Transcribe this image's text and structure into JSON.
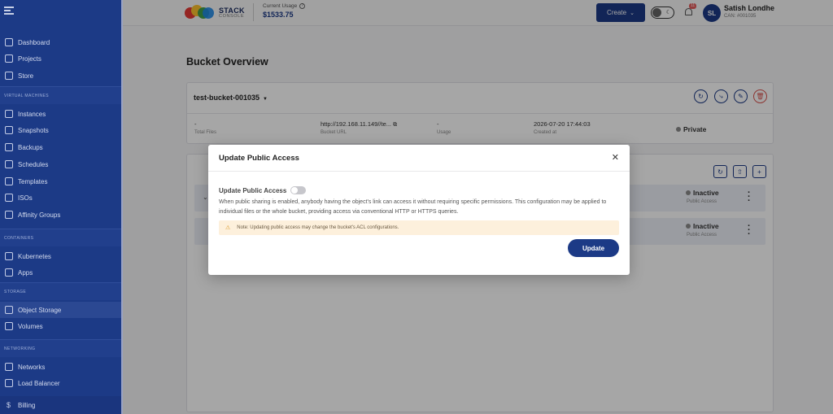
{
  "sidebar": {
    "top_items": [
      {
        "label": "Dashboard",
        "icon": "home-icon"
      },
      {
        "label": "Projects",
        "icon": "box-icon"
      },
      {
        "label": "Store",
        "icon": "cart-icon"
      }
    ],
    "sections": [
      {
        "title": "VIRTUAL MACHINES",
        "items": [
          {
            "label": "Instances",
            "icon": "gear-icon"
          },
          {
            "label": "Snapshots",
            "icon": "camera-icon"
          },
          {
            "label": "Backups",
            "icon": "backup-icon"
          },
          {
            "label": "Schedules",
            "icon": "schedule-icon"
          },
          {
            "label": "Templates",
            "icon": "template-icon"
          },
          {
            "label": "ISOs",
            "icon": "disc-icon"
          },
          {
            "label": "Affinity Groups",
            "icon": "group-icon"
          }
        ]
      },
      {
        "title": "CONTAINERS",
        "items": [
          {
            "label": "Kubernetes",
            "icon": "kubernetes-icon"
          },
          {
            "label": "Apps",
            "icon": "apps-icon"
          }
        ]
      },
      {
        "title": "STORAGE",
        "items": [
          {
            "label": "Object Storage",
            "icon": "bucket-icon",
            "active": true
          },
          {
            "label": "Volumes",
            "icon": "volume-icon"
          }
        ]
      },
      {
        "title": "NETWORKING",
        "items": [
          {
            "label": "Networks",
            "icon": "network-icon"
          },
          {
            "label": "Load Balancer",
            "icon": "load-balancer-icon"
          }
        ]
      }
    ],
    "billing": {
      "label": "Billing",
      "icon": "dollar-icon"
    }
  },
  "topbar": {
    "logo_line1": "STACK",
    "logo_line2": "CONSOLE",
    "usage_label": "Current Usage",
    "usage_value": "$1533.75",
    "create_label": "Create",
    "notification_count": "11",
    "avatar_initials": "SL",
    "user_name": "Satish Londhe",
    "user_id": "CAN: #001035"
  },
  "page": {
    "title": "Bucket Overview",
    "bucket_name": "test-bucket-001035",
    "stats": [
      {
        "value": "-",
        "label": "Total Files"
      },
      {
        "value": "http://192.168.11.149//te...",
        "label": "Bucket URL"
      },
      {
        "value": "-",
        "label": "Usage"
      },
      {
        "value": "2026-07-20 17:44:03",
        "label": "Created at"
      }
    ],
    "access": "Private",
    "rows": [
      {
        "status": "Inactive",
        "label": "Public Access"
      },
      {
        "status": "Inactive",
        "label": "Public Access"
      }
    ]
  },
  "modal": {
    "title": "Update Public Access",
    "toggle_label": "Update Public Access",
    "toggle_on": false,
    "description": "When public sharing is enabled, anybody having the object's link can access it without requiring specific permissions. This configuration may be applied to individual files or the whole bucket, providing access via conventional HTTP or HTTPS queries.",
    "note": "Note: Updating public access may change the bucket's ACL configurations.",
    "update_label": "Update"
  },
  "colors": {
    "primary": "#1c3a86",
    "danger": "#d9534f",
    "note_bg": "#fdf0dc"
  }
}
